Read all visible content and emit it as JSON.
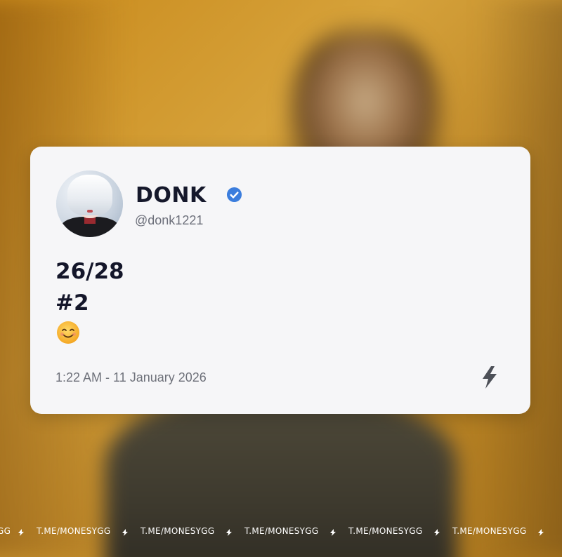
{
  "post": {
    "display_name": "DONK",
    "handle": "@donk1221",
    "verified": true,
    "verified_color": "#3b7ddd",
    "lines": [
      "26/28",
      "#2"
    ],
    "emoji": "😊",
    "timestamp": "1:22 AM - 11 January 2026",
    "avatar_icon": "anime-avatar-icon",
    "action_icon": "lightning-bolt-icon"
  },
  "ticker": {
    "text": "T.ME/MONESYGG",
    "items": [
      "GG",
      "T.ME/MONESYGG",
      "T.ME/MONESYGG",
      "T.ME/MONESYGG",
      "T.ME/MONESYGG",
      "T.ME/MONESYGG"
    ],
    "separator_icon": "arrow-separator-icon"
  },
  "colors": {
    "background_accent": "#c98a1c",
    "card": "#f6f6f8",
    "name_text": "#15182b",
    "muted_text": "#6e717a"
  }
}
